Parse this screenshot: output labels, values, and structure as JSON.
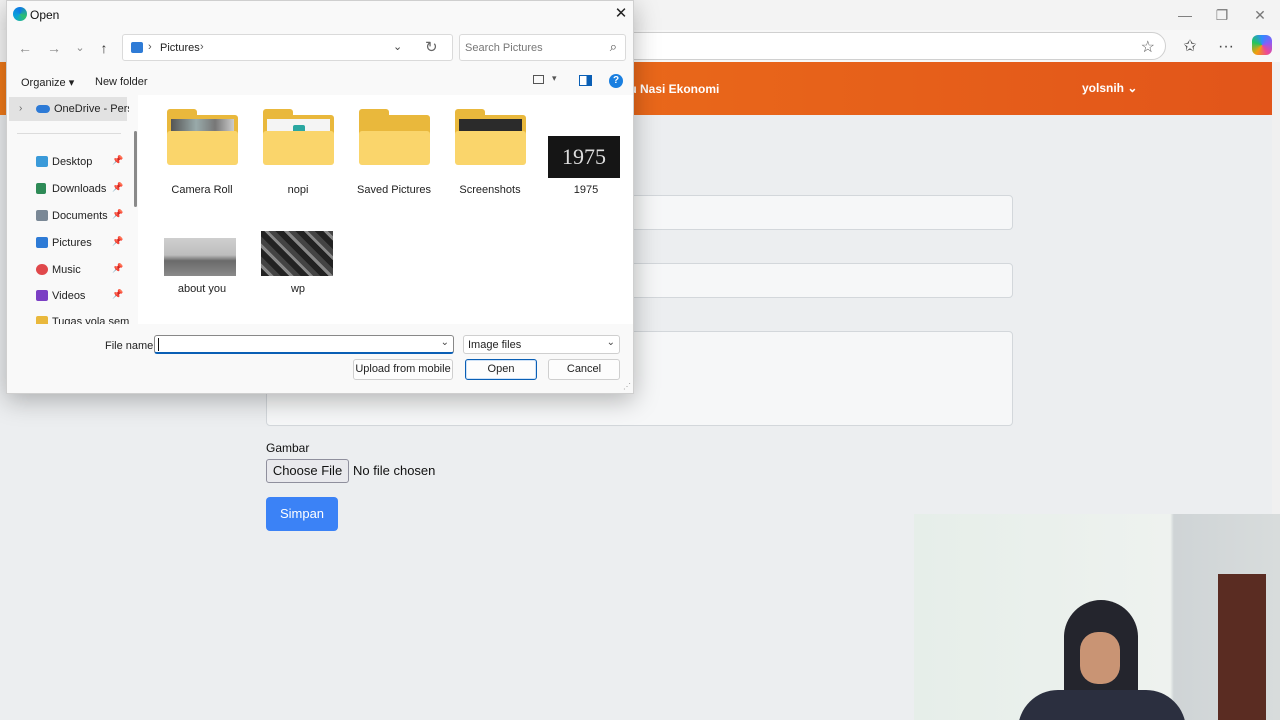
{
  "browser": {
    "window_controls": {
      "minimize": "—",
      "restore": "❐",
      "close": "✕"
    },
    "toolbar": {
      "favorite_icon": "☆",
      "favorites_icon": "✩",
      "more_icon": "···"
    }
  },
  "navbar": {
    "brand": "nu Nasi Ekonomi",
    "user": "yolsnih",
    "user_chevron": "⌄",
    "colors": {
      "start": "#f07a1a",
      "end": "#e2551a"
    }
  },
  "form": {
    "gambar_label": "Gambar",
    "choose_file": "Choose File",
    "no_file": "No file chosen",
    "submit": "Simpan",
    "accent": "#3b82f6"
  },
  "dialog": {
    "title": "Open",
    "close_icon": "✕",
    "nav": {
      "back": "←",
      "forward": "→",
      "recent": "⌄",
      "up": "↑"
    },
    "path": {
      "sep": "›",
      "folder": "Pictures",
      "sep2": "›",
      "dropdown": "⌄",
      "refresh": "↻"
    },
    "search_placeholder": "Search Pictures",
    "search_icon": "⌕",
    "commands": {
      "organize": "Organize ▾",
      "new_folder": "New folder",
      "view_dd": "▾",
      "help": "?"
    },
    "sidebar": {
      "onedrive_chevron": "›",
      "onedrive": "OneDrive - Personal",
      "items": [
        {
          "label": "Desktop",
          "pin": "📌"
        },
        {
          "label": "Downloads",
          "pin": "📌"
        },
        {
          "label": "Documents",
          "pin": "📌"
        },
        {
          "label": "Pictures",
          "pin": "📌"
        },
        {
          "label": "Music",
          "pin": "📌"
        },
        {
          "label": "Videos",
          "pin": "📌"
        },
        {
          "label": "Tugas yola semester"
        }
      ]
    },
    "files": [
      {
        "name": "Camera Roll",
        "kind": "folder"
      },
      {
        "name": "nopi",
        "kind": "folder"
      },
      {
        "name": "Saved Pictures",
        "kind": "folder"
      },
      {
        "name": "Screenshots",
        "kind": "folder"
      },
      {
        "name": "1975",
        "kind": "image",
        "thumb_text": "1975"
      },
      {
        "name": "about you",
        "kind": "image"
      },
      {
        "name": "wp",
        "kind": "image"
      }
    ],
    "file_name_label": "File name:",
    "file_name_value": "",
    "dropdown_icon": "⌄",
    "file_type": "Image files",
    "buttons": {
      "upload": "Upload from mobile",
      "open": "Open",
      "cancel": "Cancel"
    },
    "grip": "⋰"
  }
}
